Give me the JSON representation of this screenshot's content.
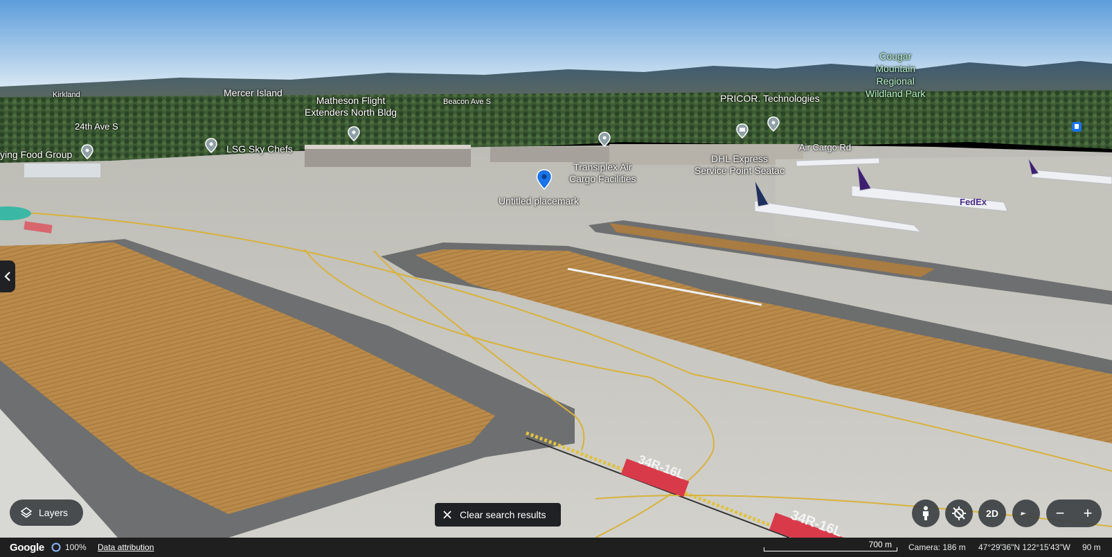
{
  "map": {
    "labels": {
      "kirkland": "Kirkland",
      "mercer_island": "Mercer Island",
      "matheson": "Matheson Flight\nExtenders North Bldg",
      "beacon": "Beacon Ave S",
      "pricor": "PRICOR. Technologies",
      "cougar": "Cougar\nMountain\nRegional\nWildland Park",
      "ave24": "24th Ave S",
      "flying_food": "ying Food Group",
      "lsg": "LSG Sky Chefs",
      "transiplex": "Transiplex Air\nCargo Facilities",
      "dhl": "DHL Express\nService Point Seatac",
      "air_cargo_rd": "Air Cargo Rd",
      "untitled_placemark": "Untitled placemark",
      "runway_marking_1": "34R-16L",
      "runway_marking_2": "34R-16L",
      "fedex_livery": "FedEx"
    },
    "colors": {
      "sky_top": "#6aa7df",
      "sky_bottom": "#dbe9f4",
      "grass": "#b98a4a",
      "tarmac": "#c9c8c3",
      "taxiway_dark": "#6b6c6c",
      "placemark_blue": "#1a73e8",
      "runway_red": "#d83a4a"
    }
  },
  "controls": {
    "layers_label": "Layers",
    "clear_search_label": "Clear search results",
    "mode_2d_label": "2D",
    "zoom_out_symbol": "−",
    "zoom_in_symbol": "+"
  },
  "footer": {
    "logo": "Google",
    "loading_percent": "100%",
    "data_attribution": "Data attribution",
    "scale_label": "700 m",
    "camera": "Camera: 186 m",
    "coordinates": "47°29'36\"N 122°15'43\"W",
    "elevation": "90 m"
  }
}
